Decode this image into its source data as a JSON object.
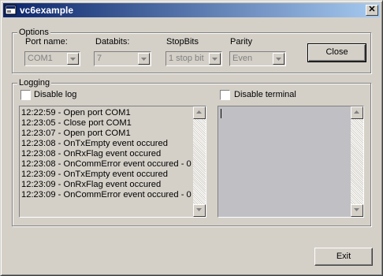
{
  "window": {
    "title": "vc6example",
    "close_glyph": "✕"
  },
  "options": {
    "label": "Options",
    "port": {
      "label": "Port name:",
      "value": "COM1"
    },
    "databits": {
      "label": "Databits:",
      "value": "7"
    },
    "stopbits": {
      "label": "StopBits",
      "value": "1 stop bit"
    },
    "parity": {
      "label": "Parity",
      "value": "Even"
    },
    "close_label": "Close"
  },
  "logging": {
    "label": "Logging",
    "disable_log_label": "Disable log",
    "disable_terminal_label": "Disable terminal",
    "lines": [
      "12:22:59 - Open port COM1",
      "12:23:05 - Close port COM1",
      "12:23:07 - Open port COM1",
      "12:23:08 - OnTxEmpty event occured",
      "12:23:08 - OnRxFlag event occured",
      "12:23:08 - OnCommError event occured - 0",
      "12:23:09 - OnTxEmpty event occured",
      "12:23:09 - OnRxFlag event occured",
      "12:23:09 - OnCommError event occured - 0"
    ]
  },
  "exit_label": "Exit",
  "colors": {
    "title_start": "#0a246a",
    "title_end": "#a6caf0",
    "face": "#d4d0c8",
    "terminal_bg": "#c0c0c4"
  }
}
